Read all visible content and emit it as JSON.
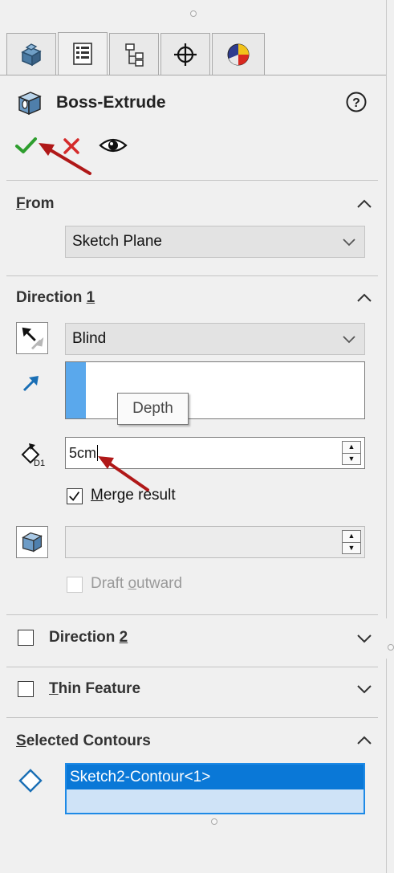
{
  "tabs": [
    {
      "icon": "feature-manager-icon",
      "active": false
    },
    {
      "icon": "property-manager-icon",
      "active": true
    },
    {
      "icon": "configuration-manager-icon",
      "active": false
    },
    {
      "icon": "dimxpert-manager-icon",
      "active": false
    },
    {
      "icon": "display-manager-icon",
      "active": false
    }
  ],
  "header": {
    "title": "Boss-Extrude",
    "help_icon": "help-icon",
    "ok_icon": "checkmark-icon",
    "cancel_icon": "cancel-x-icon",
    "preview_icon": "eye-icon"
  },
  "from": {
    "title_first": "F",
    "title_rest": "rom",
    "value": "Sketch Plane"
  },
  "direction1": {
    "title_main": "Direction ",
    "title_key": "1",
    "end_condition": "Blind",
    "depth_tooltip": "Depth",
    "depth_value": "5cm",
    "merge_first": "M",
    "merge_rest": "erge result",
    "merge_checked": true,
    "draft_value": "",
    "draft_outward_pre": "Draft ",
    "draft_outward_key": "o",
    "draft_outward_rest": "utward"
  },
  "direction2": {
    "title_main": "Direction ",
    "title_key": "2",
    "checked": false
  },
  "thin_feature": {
    "title_first": "T",
    "title_rest": "hin Feature",
    "checked": false
  },
  "selected_contours": {
    "title_first": "S",
    "title_rest": "elected Contours",
    "items": [
      "Sketch2-Contour<1>"
    ]
  },
  "colors": {
    "accept_green": "#2e9e2e",
    "cancel_red": "#d42a2a",
    "selection_blue": "#0a78d7",
    "annotation_arrow": "#b01818"
  }
}
